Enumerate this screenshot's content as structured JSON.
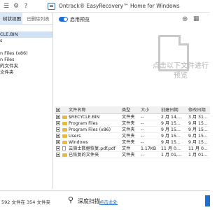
{
  "titlebar": {
    "app_title": "Ontrack® EasyRecovery™ Home for Windows",
    "icons": [
      "menu-icon",
      "settings-icon",
      "help-icon"
    ]
  },
  "left_panel": {
    "tabs": [
      {
        "label": "树状视图",
        "selected": true
      },
      {
        "label": "已删除列表",
        "selected": false
      }
    ],
    "tree": [
      {
        "label": ""
      },
      {
        "label": "CLE.BIN",
        "selected": true
      },
      {
        "label": "s"
      },
      {
        "label": ""
      },
      {
        "label": "n Files (x86)"
      },
      {
        "label": "n Files"
      },
      {
        "label": "的文件夹"
      },
      {
        "label": "文件夹"
      }
    ]
  },
  "preview": {
    "toggle_label": "启用预览",
    "toggle_on": true,
    "hint": "点击以下文件进行预览"
  },
  "table": {
    "columns": [
      "文件名称",
      "类型",
      "大小",
      "创建日期",
      "修改日期"
    ],
    "rows": [
      {
        "name": "$RECYCLE.BIN",
        "type": "文件夹",
        "size": "--",
        "created": "2 月 14,...",
        "modified": "3 月 31...",
        "kind": "folder"
      },
      {
        "name": "Program Files",
        "type": "文件夹",
        "size": "--",
        "created": "9 月 15...",
        "modified": "9 月 15...",
        "kind": "folder"
      },
      {
        "name": "Program Files (x86)",
        "type": "文件夹",
        "size": "--",
        "created": "9 月 15...",
        "modified": "9 月 15...",
        "kind": "folder"
      },
      {
        "name": "Users",
        "type": "文件夹",
        "size": "--",
        "created": "9 月 15...",
        "modified": "9 月 15...",
        "kind": "folder"
      },
      {
        "name": "Windows",
        "type": "文件夹",
        "size": "--",
        "created": "9 月 15...",
        "modified": "9 月 15...",
        "kind": "folder"
      },
      {
        "name": "云骑士数据恢复.pdf.pdf",
        "type": "文件",
        "size": "1.17KB",
        "created": "11 月 0...",
        "modified": "11 月 0...",
        "kind": "file"
      },
      {
        "name": "已恢复的文件夹",
        "type": "文件夹",
        "size": "--",
        "created": "1 月 01,...",
        "modified": "1 月 01...",
        "kind": "folder"
      }
    ]
  },
  "statusbar": {
    "summary": "592 文件在 354 文件夹",
    "deep_scan_label": "深度扫描",
    "deep_scan_link": "点击此处"
  },
  "colors": {
    "accent": "#1f6fd1",
    "selection": "#cfe2f5",
    "folder": "#e8b93a"
  }
}
